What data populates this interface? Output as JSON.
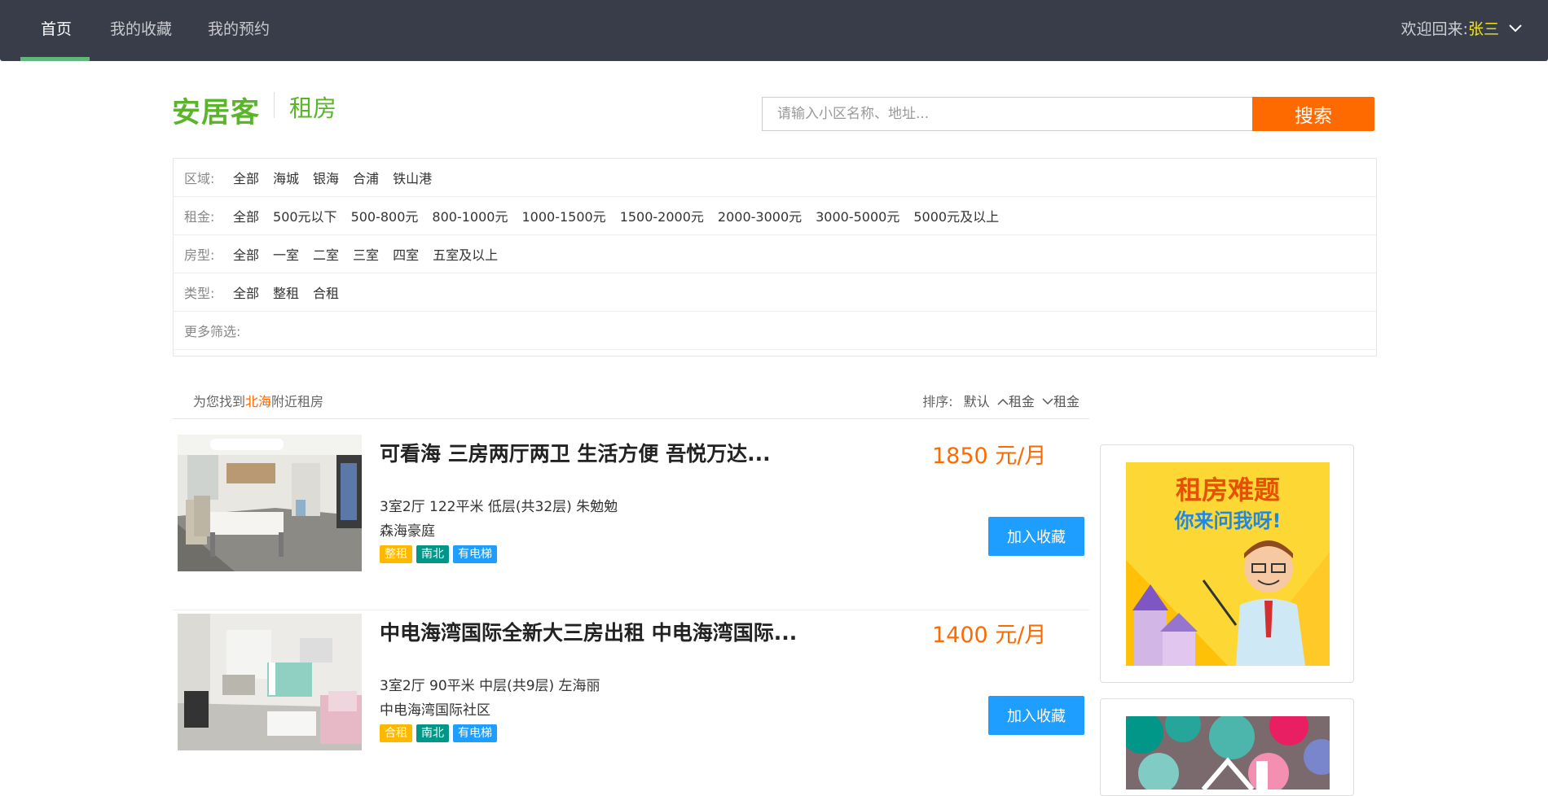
{
  "nav": {
    "items": [
      {
        "label": "首页",
        "active": true
      },
      {
        "label": "我的收藏",
        "active": false
      },
      {
        "label": "我的预约",
        "active": false
      }
    ],
    "welcome_prefix": "欢迎回来:",
    "username": "张三"
  },
  "brand": {
    "logo": "安居客",
    "section": "租房"
  },
  "search": {
    "placeholder": "请输入小区名称、地址...",
    "button_label": "搜索"
  },
  "filters": {
    "area": {
      "label": "区域:",
      "options": [
        "全部",
        "海城",
        "银海",
        "合浦",
        "铁山港"
      ]
    },
    "rent": {
      "label": "租金:",
      "options": [
        "全部",
        "500元以下",
        "500-800元",
        "800-1000元",
        "1000-1500元",
        "1500-2000元",
        "2000-3000元",
        "3000-5000元",
        "5000元及以上"
      ]
    },
    "layout": {
      "label": "房型:",
      "options": [
        "全部",
        "一室",
        "二室",
        "三室",
        "四室",
        "五室及以上"
      ]
    },
    "type": {
      "label": "类型:",
      "options": [
        "全部",
        "整租",
        "合租"
      ]
    },
    "more": {
      "label": "更多筛选:"
    }
  },
  "results": {
    "prefix": "为您找到",
    "city": "北海",
    "suffix": "附近租房",
    "sort_label": "排序:",
    "sort_default": "默认",
    "sort_rent_up": "租金",
    "sort_rent_down": "租金"
  },
  "listings": [
    {
      "title": "可看海 三房两厅两卫 生活方便 吾悦万达...",
      "price": "1850 元/月",
      "meta": "3室2厅 122平米 低层(共32层) 朱勉勉",
      "community": "森海豪庭",
      "tags": [
        {
          "text": "整租",
          "color": "#ffb800"
        },
        {
          "text": "南北",
          "color": "#009688"
        },
        {
          "text": "有电梯",
          "color": "#1e9fff"
        }
      ],
      "fav_label": "加入收藏"
    },
    {
      "title": "中电海湾国际全新大三房出租 中电海湾国际...",
      "price": "1400 元/月",
      "meta": "3室2厅 90平米 中层(共9层) 左海丽",
      "community": "中电海湾国际社区",
      "tags": [
        {
          "text": "合租",
          "color": "#ffb800"
        },
        {
          "text": "南北",
          "color": "#009688"
        },
        {
          "text": "有电梯",
          "color": "#1e9fff"
        }
      ],
      "fav_label": "加入收藏"
    }
  ],
  "ads": {
    "ad1_line1": "租房难题",
    "ad1_line2": "你来问我呀!"
  },
  "colors": {
    "nav_bg": "#393d49",
    "brand_green": "#5ab52b",
    "accent_orange": "#ff6a00",
    "primary_blue": "#1e9fff"
  }
}
